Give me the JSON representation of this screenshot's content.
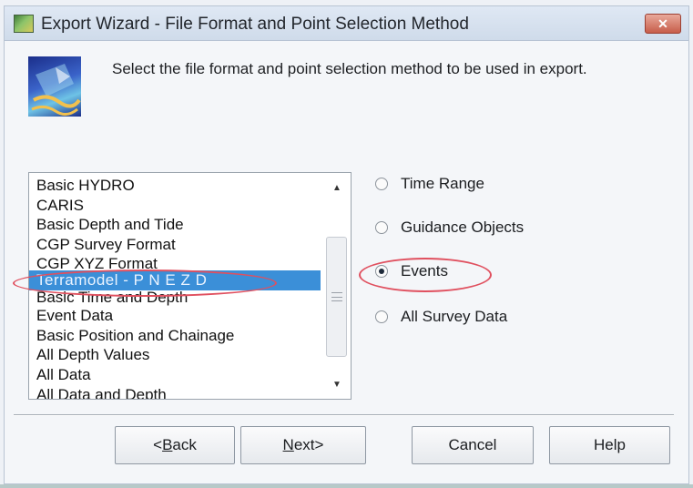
{
  "window": {
    "title": "Export Wizard - File Format and Point Selection Method",
    "close_label": "✕"
  },
  "header": {
    "instruction": "Select the file format and point selection method to be used in export."
  },
  "formats": {
    "items": [
      "Basic HYDRO",
      "CARIS",
      "Basic Depth and Tide",
      "CGP Survey Format",
      "CGP XYZ Format",
      "Terramodel - P N E Z D",
      "Basic Time and Depth",
      "Event Data",
      "Basic Position and Chainage",
      "All Depth Values",
      "All Data",
      "All Data and Depth"
    ],
    "selected": "Terramodel - P N E Z D"
  },
  "methods": {
    "options": [
      "Time Range",
      "Guidance Objects",
      "Events",
      "All Survey Data"
    ],
    "selected": "Events"
  },
  "buttons": {
    "back": {
      "underline": "B",
      "rest_before": "<",
      "rest_after": "ack"
    },
    "next": {
      "underline": "N",
      "rest_after": "ext>"
    },
    "cancel": "Cancel",
    "help": "Help"
  },
  "colors": {
    "selection": "#3b8fd8",
    "annotation": "#e0505f"
  }
}
